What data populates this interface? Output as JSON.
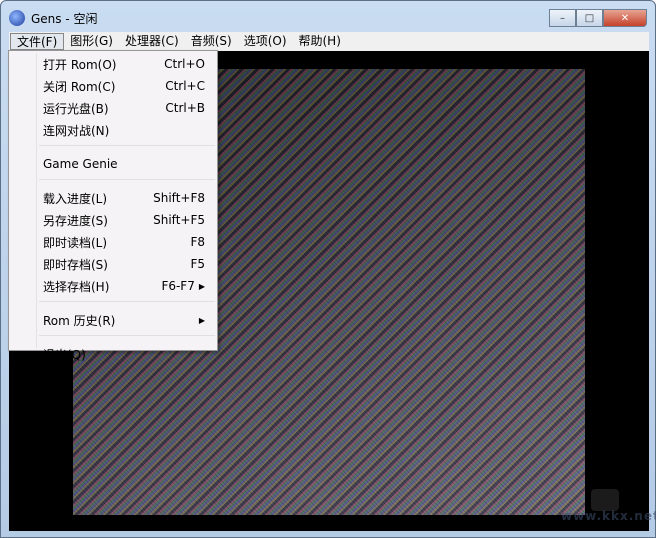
{
  "window": {
    "title": "Gens - 空闲",
    "minimize": "–",
    "maximize": "□",
    "close": "✕"
  },
  "menubar": [
    "文件(F)",
    "图形(G)",
    "处理器(C)",
    "音频(S)",
    "选项(O)",
    "帮助(H)"
  ],
  "file_menu": {
    "group1": [
      {
        "label": "打开 Rom(O)",
        "shortcut": "Ctrl+O"
      },
      {
        "label": "关闭 Rom(C)",
        "shortcut": "Ctrl+C"
      },
      {
        "label": "运行光盘(B)",
        "shortcut": "Ctrl+B"
      },
      {
        "label": "连网对战(N)",
        "shortcut": ""
      }
    ],
    "group2": [
      {
        "label": "Game Genie",
        "shortcut": ""
      }
    ],
    "group3": [
      {
        "label": "载入进度(L)",
        "shortcut": "Shift+F8"
      },
      {
        "label": "另存进度(S)",
        "shortcut": "Shift+F5"
      },
      {
        "label": "即时读档(L)",
        "shortcut": "F8"
      },
      {
        "label": "即时存档(S)",
        "shortcut": "F5"
      },
      {
        "label": "选择存档(H)",
        "shortcut": "F6-F7"
      }
    ],
    "group4": [
      {
        "label": "Rom 历史(R)",
        "shortcut": ""
      }
    ],
    "group5": [
      {
        "label": "退出(Q)",
        "shortcut": ""
      }
    ]
  },
  "watermark": "www.kkx.net"
}
